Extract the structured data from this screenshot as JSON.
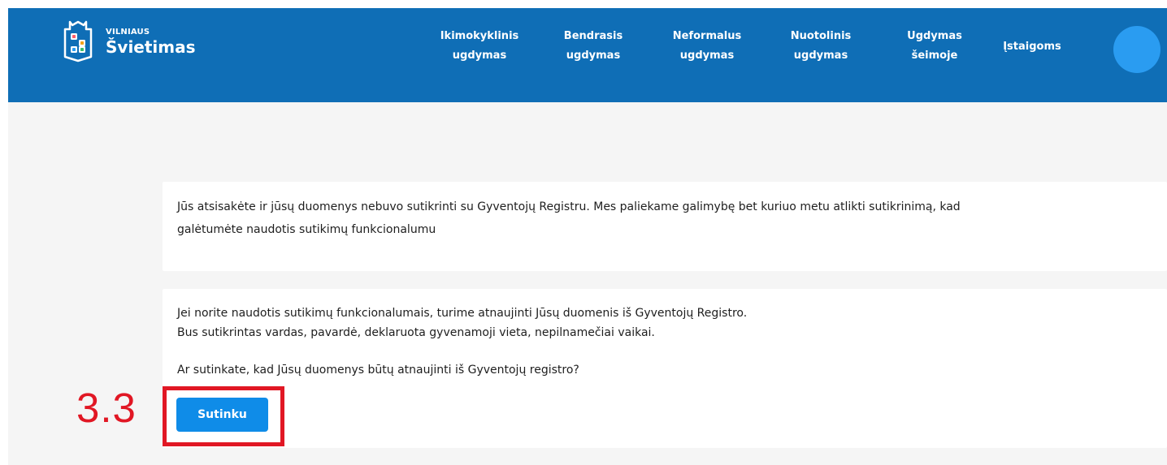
{
  "header": {
    "brand": {
      "top": "VILNIAUS",
      "main": "Švietimas"
    },
    "nav": [
      {
        "lines": [
          "Ikimokyklinis",
          "ugdymas"
        ]
      },
      {
        "lines": [
          "Bendrasis",
          "ugdymas"
        ]
      },
      {
        "lines": [
          "Neformalus",
          "ugdymas"
        ]
      },
      {
        "lines": [
          "Nuotolinis",
          "ugdymas"
        ]
      },
      {
        "lines": [
          "Ugdymas",
          "šeimoje"
        ]
      },
      {
        "lines": [
          "Įstaigoms"
        ]
      }
    ]
  },
  "cards": {
    "decline_message": {
      "line_1": "Jūs atsisakėte ir jūsų duomenys nebuvo sutikrinti su Gyventojų Registru. Mes paliekame galimybę bet kuriuo metu atlikti sutikrinimą, kad",
      "line_2": "galėtumėte naudotis sutikimų funkcionalumu"
    },
    "consent": {
      "line_1": "Jei norite naudotis sutikimų funkcionalumais, turime atnaujinti Jūsų duomenis iš Gyventojų Registro.",
      "line_2": "Bus sutikrintas vardas, pavardė, deklaruota gyvenamoji vieta, nepilnamečiai vaikai.",
      "question": "Ar sutinkate, kad Jūsų duomenys būtų atnaujinti iš Gyventojų registro?",
      "button_label": "Sutinku"
    }
  },
  "annotation": {
    "label": "3.3",
    "color": "#e11724"
  },
  "colors": {
    "header_blue": "#0f6eb6",
    "avatar_blue": "#2a9cf1",
    "button_blue": "#0f8ce8",
    "page_gray": "#f5f5f5"
  },
  "icons": {
    "logo": "school-cube-icon",
    "avatar": "avatar-circle"
  }
}
